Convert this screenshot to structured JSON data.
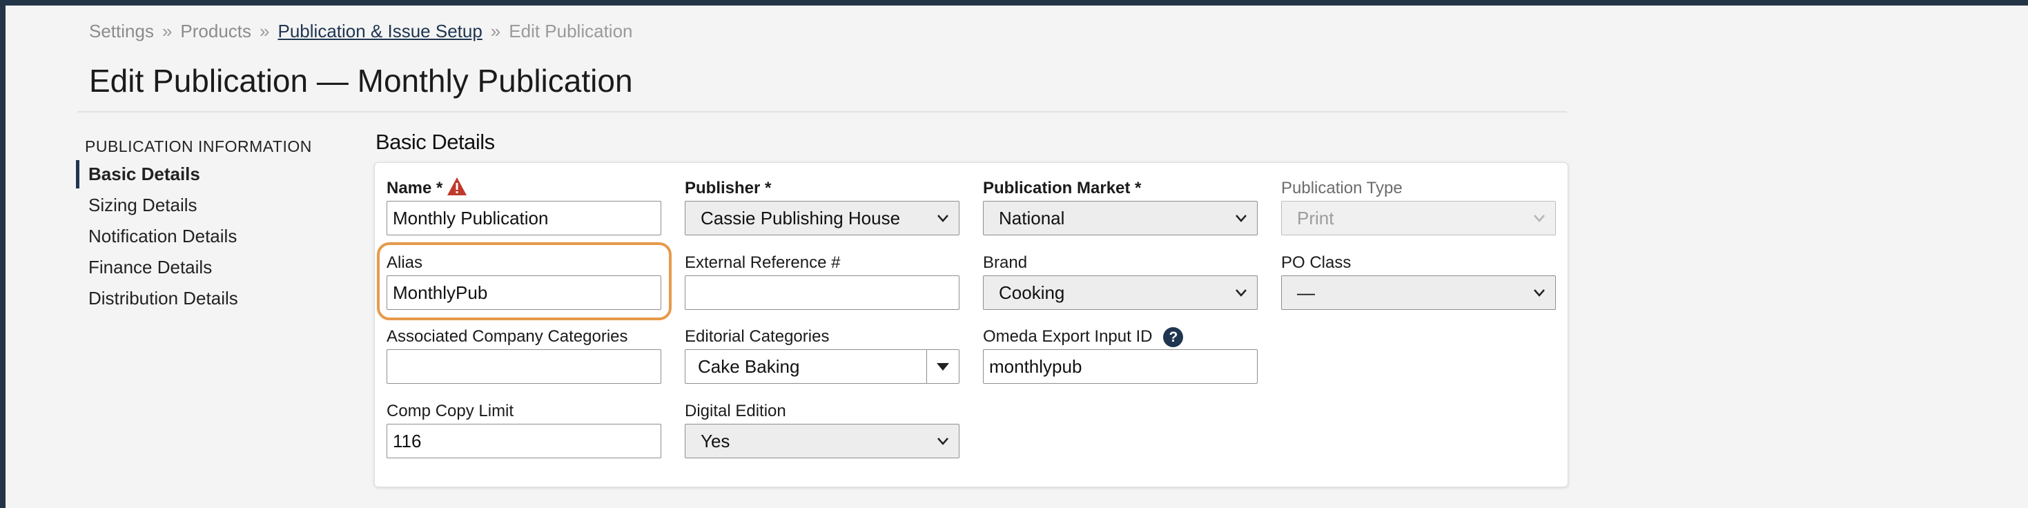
{
  "breadcrumb": {
    "items": [
      "Settings",
      "Products"
    ],
    "link": "Publication & Issue Setup",
    "current": "Edit Publication",
    "separator": "»"
  },
  "page": {
    "title": "Edit Publication — Monthly Publication"
  },
  "sidebar": {
    "heading": "PUBLICATION INFORMATION",
    "items": [
      {
        "label": "Basic Details",
        "active": true
      },
      {
        "label": "Sizing Details"
      },
      {
        "label": "Notification Details"
      },
      {
        "label": "Finance Details"
      },
      {
        "label": "Distribution Details"
      }
    ]
  },
  "section": {
    "title": "Basic Details"
  },
  "form": {
    "name": {
      "label": "Name *",
      "value": "Monthly Publication",
      "icon": "warning-icon"
    },
    "publisher": {
      "label": "Publisher *",
      "value": "Cassie Publishing House"
    },
    "publication_market": {
      "label": "Publication Market *",
      "value": "National"
    },
    "publication_type": {
      "label": "Publication Type",
      "value": "Print",
      "disabled": true
    },
    "alias": {
      "label": "Alias",
      "value": "MonthlyPub"
    },
    "external_reference": {
      "label": "External Reference #",
      "value": ""
    },
    "brand": {
      "label": "Brand",
      "value": "Cooking"
    },
    "po_class": {
      "label": "PO Class",
      "value": "—"
    },
    "associated_company_categories": {
      "label": "Associated Company Categories",
      "value": ""
    },
    "editorial_categories": {
      "label": "Editorial Categories",
      "value": "Cake Baking"
    },
    "omeda_export_input_id": {
      "label": "Omeda Export Input ID",
      "value": "monthlypub",
      "help_glyph": "?"
    },
    "comp_copy_limit": {
      "label": "Comp Copy Limit",
      "value": "116"
    },
    "digital_edition": {
      "label": "Digital Edition",
      "value": "Yes"
    }
  },
  "colors": {
    "navy": "#1f3550",
    "highlight": "#e69a4b",
    "warning": "#c0392b"
  }
}
